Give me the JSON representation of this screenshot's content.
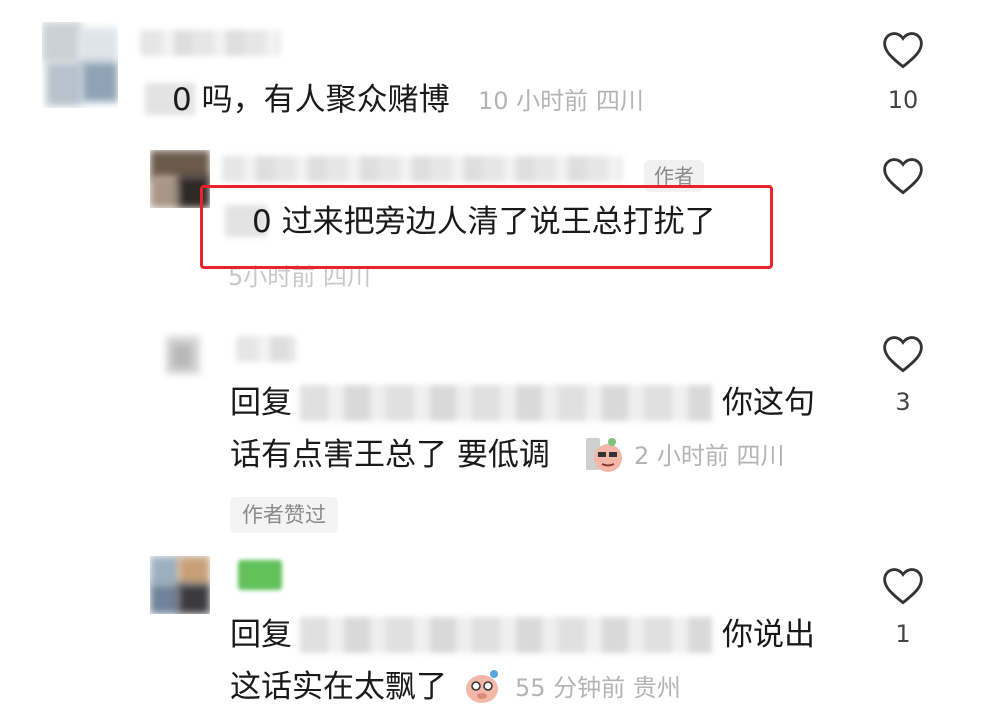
{
  "comments": [
    {
      "text_visible": "0 吗，有人聚众赌博",
      "time": "10 小时前",
      "location": "四川",
      "likes": "10"
    },
    {
      "author_tag": "作者",
      "text_visible": "0 过来把旁边人清了说王总打扰了",
      "time": "5小时前",
      "location": "四川"
    },
    {
      "reply_prefix": "回复",
      "line1_suffix": "你这句",
      "line2": "话有点害王总了  要低调",
      "time": "2 小时前",
      "location": "四川",
      "likes": "3",
      "author_liked": "作者赞过"
    },
    {
      "reply_prefix": "回复",
      "line1_suffix": "你说出",
      "line2": "这话实在太飘了",
      "time": "55 分钟前",
      "location": "贵州",
      "likes": "1"
    }
  ],
  "colors": {
    "highlight": "#e8232b",
    "meta": "#b4b4b4"
  },
  "icons": [
    "heart-icon",
    "blurred-avatar",
    "emoji-sticker"
  ]
}
